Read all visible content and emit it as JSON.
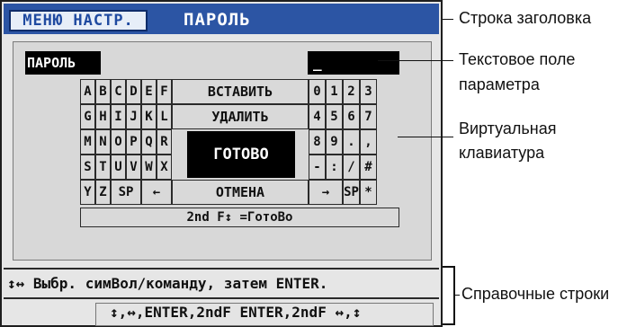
{
  "screen": {
    "menu_tab": "МЕНЮ НАСТР.",
    "title": "ПАРОЛЬ",
    "param_label": "ПАРОЛЬ",
    "param_value": "_",
    "keyboard": {
      "letters": [
        [
          "A",
          "B",
          "C",
          "D",
          "E",
          "F"
        ],
        [
          "G",
          "H",
          "I",
          "J",
          "K",
          "L"
        ],
        [
          "M",
          "N",
          "O",
          "P",
          "Q",
          "R"
        ],
        [
          "S",
          "T",
          "U",
          "V",
          "W",
          "X"
        ],
        [
          "Y",
          "Z",
          "SP",
          "←"
        ]
      ],
      "cmd_insert": "ВСТАВИТЬ",
      "cmd_delete": "УДАЛИТЬ",
      "cmd_done": "ГОТОВО",
      "cmd_cancel": "ОТМЕНА",
      "digits_rows": [
        [
          "0",
          "1",
          "2",
          "3"
        ],
        [
          "4",
          "5",
          "6",
          "7"
        ],
        [
          "8",
          "9",
          ".",
          ","
        ],
        [
          "-",
          ":",
          "/",
          "#"
        ],
        [
          "→",
          "SP",
          "*"
        ]
      ],
      "hint": "2nd F↕ =ГотоВо"
    },
    "help_line_1": "↕↔ Выбр. симВол/команду, затем ENTER.",
    "help_line_2": "↕,↔,ENTER,2ndF ENTER,2ndF ↔,↕"
  },
  "callouts": {
    "title_bar": "Строка заголовка",
    "text_field_1": "Текстовое поле",
    "text_field_2": "параметра",
    "keyboard_1": "Виртуальная",
    "keyboard_2": "клавиатура",
    "help_lines": "Справочные строки"
  }
}
